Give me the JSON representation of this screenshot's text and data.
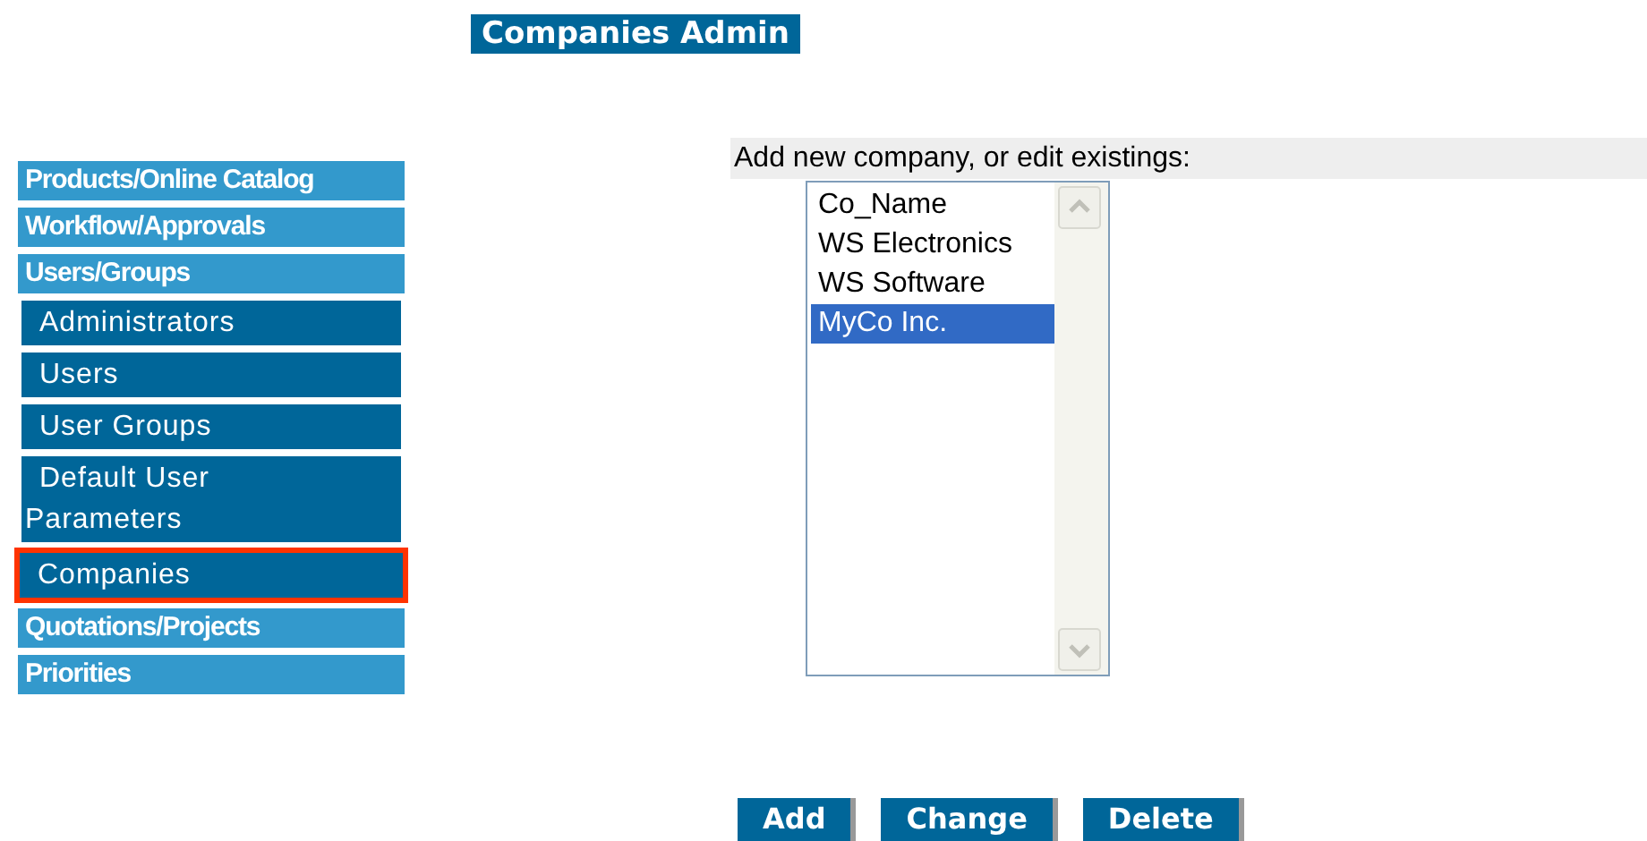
{
  "title": "Companies Admin",
  "sidebar": {
    "items": [
      {
        "label": "Products/Online Catalog"
      },
      {
        "label": "Workflow/Approvals"
      },
      {
        "label": "Users/Groups",
        "children": [
          {
            "label": "Administrators",
            "selected": false
          },
          {
            "label": "Users",
            "selected": false
          },
          {
            "label": "User Groups",
            "selected": false
          },
          {
            "label": "Default User Parameters",
            "selected": false
          },
          {
            "label": "Companies",
            "selected": true
          }
        ]
      },
      {
        "label": "Quotations/Projects"
      },
      {
        "label": "Priorities"
      }
    ]
  },
  "form": {
    "label": "Add new company, or edit existings:",
    "companies": [
      {
        "name": "Co_Name",
        "selected": false
      },
      {
        "name": "WS Electronics",
        "selected": false
      },
      {
        "name": "WS Software",
        "selected": false
      },
      {
        "name": "MyCo Inc.",
        "selected": true
      }
    ]
  },
  "buttons": [
    "Add",
    "Change",
    "Delete"
  ]
}
